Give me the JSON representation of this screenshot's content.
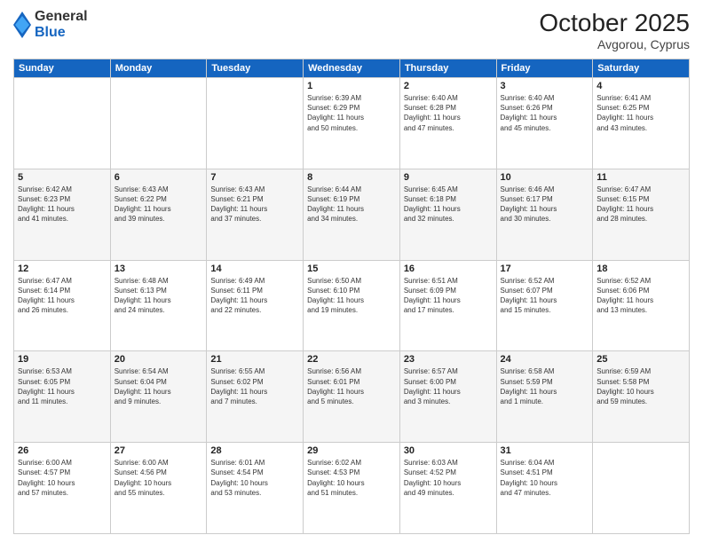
{
  "header": {
    "logo": {
      "line1": "General",
      "line2": "Blue"
    },
    "month": "October 2025",
    "location": "Avgorou, Cyprus"
  },
  "weekdays": [
    "Sunday",
    "Monday",
    "Tuesday",
    "Wednesday",
    "Thursday",
    "Friday",
    "Saturday"
  ],
  "weeks": [
    [
      {
        "day": "",
        "info": ""
      },
      {
        "day": "",
        "info": ""
      },
      {
        "day": "",
        "info": ""
      },
      {
        "day": "1",
        "info": "Sunrise: 6:39 AM\nSunset: 6:29 PM\nDaylight: 11 hours\nand 50 minutes."
      },
      {
        "day": "2",
        "info": "Sunrise: 6:40 AM\nSunset: 6:28 PM\nDaylight: 11 hours\nand 47 minutes."
      },
      {
        "day": "3",
        "info": "Sunrise: 6:40 AM\nSunset: 6:26 PM\nDaylight: 11 hours\nand 45 minutes."
      },
      {
        "day": "4",
        "info": "Sunrise: 6:41 AM\nSunset: 6:25 PM\nDaylight: 11 hours\nand 43 minutes."
      }
    ],
    [
      {
        "day": "5",
        "info": "Sunrise: 6:42 AM\nSunset: 6:23 PM\nDaylight: 11 hours\nand 41 minutes."
      },
      {
        "day": "6",
        "info": "Sunrise: 6:43 AM\nSunset: 6:22 PM\nDaylight: 11 hours\nand 39 minutes."
      },
      {
        "day": "7",
        "info": "Sunrise: 6:43 AM\nSunset: 6:21 PM\nDaylight: 11 hours\nand 37 minutes."
      },
      {
        "day": "8",
        "info": "Sunrise: 6:44 AM\nSunset: 6:19 PM\nDaylight: 11 hours\nand 34 minutes."
      },
      {
        "day": "9",
        "info": "Sunrise: 6:45 AM\nSunset: 6:18 PM\nDaylight: 11 hours\nand 32 minutes."
      },
      {
        "day": "10",
        "info": "Sunrise: 6:46 AM\nSunset: 6:17 PM\nDaylight: 11 hours\nand 30 minutes."
      },
      {
        "day": "11",
        "info": "Sunrise: 6:47 AM\nSunset: 6:15 PM\nDaylight: 11 hours\nand 28 minutes."
      }
    ],
    [
      {
        "day": "12",
        "info": "Sunrise: 6:47 AM\nSunset: 6:14 PM\nDaylight: 11 hours\nand 26 minutes."
      },
      {
        "day": "13",
        "info": "Sunrise: 6:48 AM\nSunset: 6:13 PM\nDaylight: 11 hours\nand 24 minutes."
      },
      {
        "day": "14",
        "info": "Sunrise: 6:49 AM\nSunset: 6:11 PM\nDaylight: 11 hours\nand 22 minutes."
      },
      {
        "day": "15",
        "info": "Sunrise: 6:50 AM\nSunset: 6:10 PM\nDaylight: 11 hours\nand 19 minutes."
      },
      {
        "day": "16",
        "info": "Sunrise: 6:51 AM\nSunset: 6:09 PM\nDaylight: 11 hours\nand 17 minutes."
      },
      {
        "day": "17",
        "info": "Sunrise: 6:52 AM\nSunset: 6:07 PM\nDaylight: 11 hours\nand 15 minutes."
      },
      {
        "day": "18",
        "info": "Sunrise: 6:52 AM\nSunset: 6:06 PM\nDaylight: 11 hours\nand 13 minutes."
      }
    ],
    [
      {
        "day": "19",
        "info": "Sunrise: 6:53 AM\nSunset: 6:05 PM\nDaylight: 11 hours\nand 11 minutes."
      },
      {
        "day": "20",
        "info": "Sunrise: 6:54 AM\nSunset: 6:04 PM\nDaylight: 11 hours\nand 9 minutes."
      },
      {
        "day": "21",
        "info": "Sunrise: 6:55 AM\nSunset: 6:02 PM\nDaylight: 11 hours\nand 7 minutes."
      },
      {
        "day": "22",
        "info": "Sunrise: 6:56 AM\nSunset: 6:01 PM\nDaylight: 11 hours\nand 5 minutes."
      },
      {
        "day": "23",
        "info": "Sunrise: 6:57 AM\nSunset: 6:00 PM\nDaylight: 11 hours\nand 3 minutes."
      },
      {
        "day": "24",
        "info": "Sunrise: 6:58 AM\nSunset: 5:59 PM\nDaylight: 11 hours\nand 1 minute."
      },
      {
        "day": "25",
        "info": "Sunrise: 6:59 AM\nSunset: 5:58 PM\nDaylight: 10 hours\nand 59 minutes."
      }
    ],
    [
      {
        "day": "26",
        "info": "Sunrise: 6:00 AM\nSunset: 4:57 PM\nDaylight: 10 hours\nand 57 minutes."
      },
      {
        "day": "27",
        "info": "Sunrise: 6:00 AM\nSunset: 4:56 PM\nDaylight: 10 hours\nand 55 minutes."
      },
      {
        "day": "28",
        "info": "Sunrise: 6:01 AM\nSunset: 4:54 PM\nDaylight: 10 hours\nand 53 minutes."
      },
      {
        "day": "29",
        "info": "Sunrise: 6:02 AM\nSunset: 4:53 PM\nDaylight: 10 hours\nand 51 minutes."
      },
      {
        "day": "30",
        "info": "Sunrise: 6:03 AM\nSunset: 4:52 PM\nDaylight: 10 hours\nand 49 minutes."
      },
      {
        "day": "31",
        "info": "Sunrise: 6:04 AM\nSunset: 4:51 PM\nDaylight: 10 hours\nand 47 minutes."
      },
      {
        "day": "",
        "info": ""
      }
    ]
  ]
}
